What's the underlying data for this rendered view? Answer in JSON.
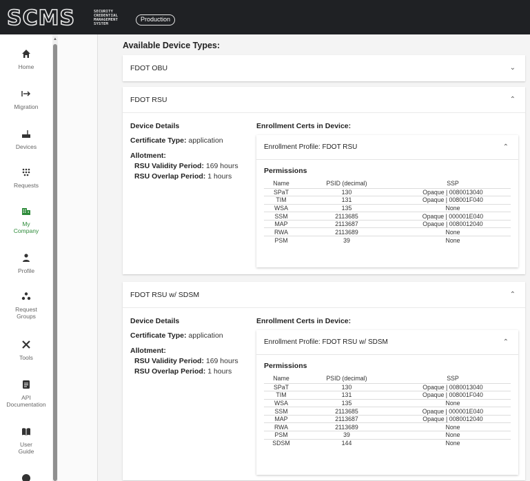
{
  "header": {
    "logo_text": "SCMS",
    "logo_subtitle": [
      "SECURITY",
      "CREDENTIAL",
      "MANAGEMENT",
      "SYSTEM"
    ],
    "environment": "Production"
  },
  "sidebar": {
    "items": [
      {
        "label": "Home",
        "icon": "home-icon"
      },
      {
        "label": "Migration",
        "icon": "migration-arrow-icon"
      },
      {
        "label": "Devices",
        "icon": "router-icon"
      },
      {
        "label": "Requests",
        "icon": "dots-grid-icon"
      },
      {
        "label": "My\nCompany",
        "icon": "building-icon",
        "active": true
      },
      {
        "label": "Profile",
        "icon": "person-icon"
      },
      {
        "label": "Request\nGroups",
        "icon": "group-icon"
      },
      {
        "label": "Tools",
        "icon": "tools-icon"
      },
      {
        "label": "API\nDocumentation",
        "icon": "document-icon"
      },
      {
        "label": "User\nGuide",
        "icon": "book-icon"
      }
    ],
    "accent_color": "#2e8b3a"
  },
  "main": {
    "section_title": "Available Device Types:",
    "device_types": [
      {
        "name": "FDOT OBU",
        "expanded": false
      },
      {
        "name": "FDOT RSU",
        "expanded": true,
        "details_title": "Device Details",
        "cert_type_label": "Certificate Type:",
        "cert_type_value": "application",
        "allotment_label": "Allotment:",
        "validity_label": "RSU Validity Period:",
        "validity_value": "169 hours",
        "overlap_label": "RSU Overlap Period:",
        "overlap_value": "1 hours",
        "certs_title": "Enrollment Certs in Device:",
        "profile_label": "Enrollment Profile: FDOT RSU",
        "permissions_title": "Permissions",
        "columns": [
          "Name",
          "PSID (decimal)",
          "SSP"
        ],
        "rows": [
          [
            "SPaT",
            "130",
            "Opaque | 0080013040"
          ],
          [
            "TIM",
            "131",
            "Opaque | 008001F040"
          ],
          [
            "WSA",
            "135",
            "None"
          ],
          [
            "SSM",
            "2113685",
            "Opaque | 000001E040"
          ],
          [
            "MAP",
            "2113687",
            "Opaque | 0080012040"
          ],
          [
            "RWA",
            "2113689",
            "None"
          ],
          [
            "PSM",
            "39",
            "None"
          ]
        ]
      },
      {
        "name": "FDOT RSU w/ SDSM",
        "expanded": true,
        "details_title": "Device Details",
        "cert_type_label": "Certificate Type:",
        "cert_type_value": "application",
        "allotment_label": "Allotment:",
        "validity_label": "RSU Validity Period:",
        "validity_value": "169 hours",
        "overlap_label": "RSU Overlap Period:",
        "overlap_value": "1 hours",
        "certs_title": "Enrollment Certs in Device:",
        "profile_label": "Enrollment Profile: FDOT RSU w/ SDSM",
        "permissions_title": "Permissions",
        "columns": [
          "Name",
          "PSID (decimal)",
          "SSP"
        ],
        "rows": [
          [
            "SPaT",
            "130",
            "Opaque | 0080013040"
          ],
          [
            "TIM",
            "131",
            "Opaque | 008001F040"
          ],
          [
            "WSA",
            "135",
            "None"
          ],
          [
            "SSM",
            "2113685",
            "Opaque | 000001E040"
          ],
          [
            "MAP",
            "2113687",
            "Opaque | 0080012040"
          ],
          [
            "RWA",
            "2113689",
            "None"
          ],
          [
            "PSM",
            "39",
            "None"
          ],
          [
            "SDSM",
            "144",
            "None"
          ]
        ]
      }
    ]
  }
}
